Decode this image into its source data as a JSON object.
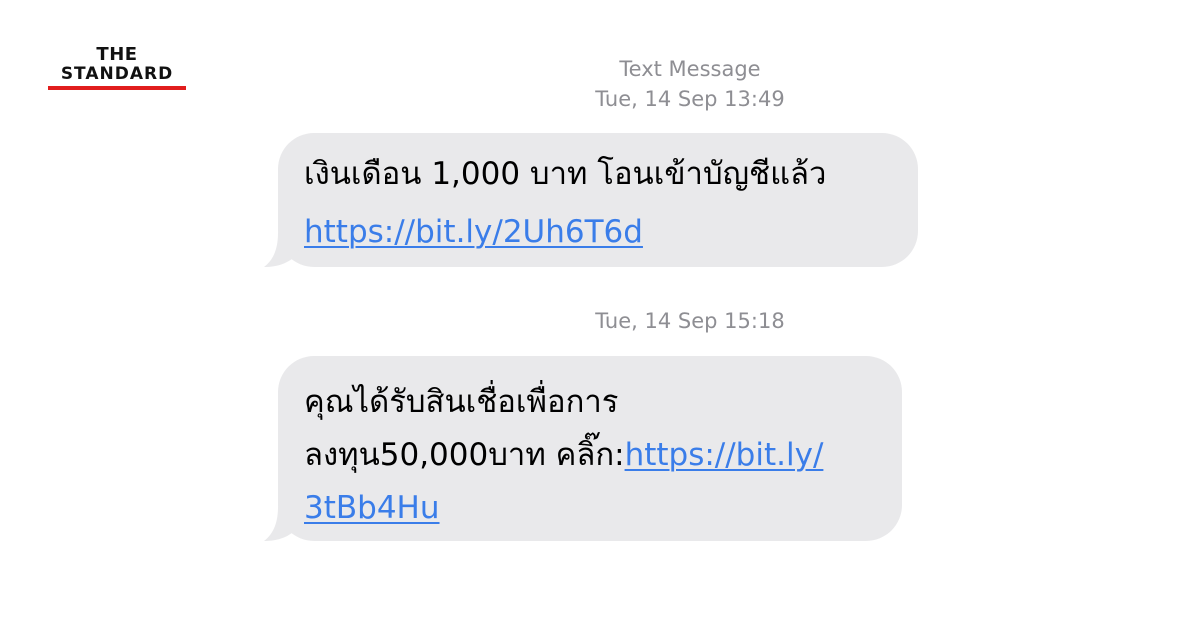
{
  "brand": {
    "line1": "THE",
    "line2": "STANDARD",
    "rule_color": "#e11d1d"
  },
  "thread": {
    "header_label": "Text Message",
    "messages": [
      {
        "timestamp": "Tue, 14 Sep 13:49",
        "text": "เงินเดือน 1,000 บาท โอนเข้าบัญชีแล้ว",
        "link": "https://bit.ly/2Uh6T6d"
      },
      {
        "timestamp": "Tue, 14 Sep 15:18",
        "line1": "คุณได้รับสินเชื่อเพื่อการ",
        "line2_text": "ลงทุน50,000บาท คลิ๊ก:",
        "link_part1": "https://bit.ly/",
        "link_part2": "3tBb4Hu"
      }
    ]
  },
  "colors": {
    "bubble": "#e9e9eb",
    "link": "#3a7de9",
    "timestamp": "#8e8e93"
  }
}
